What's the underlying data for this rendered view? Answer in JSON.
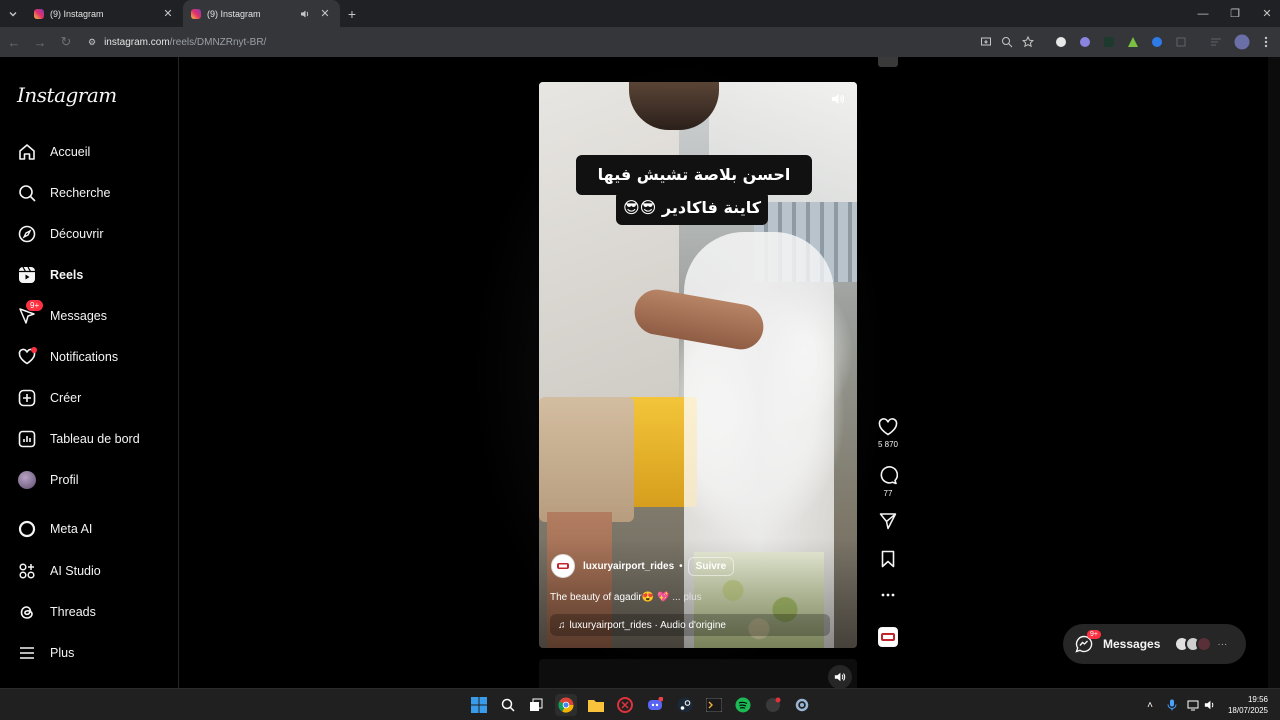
{
  "browser": {
    "tabs": [
      {
        "title": "(9) Instagram",
        "active": false
      },
      {
        "title": "(9) Instagram",
        "active": true
      }
    ],
    "url_domain": "instagram.com",
    "url_path": "/reels/DMNZRnyt-BR/"
  },
  "sidebar": {
    "logo": "Instagram",
    "items": [
      {
        "label": "Accueil",
        "icon": "home-icon"
      },
      {
        "label": "Recherche",
        "icon": "search-icon"
      },
      {
        "label": "Découvrir",
        "icon": "compass-icon"
      },
      {
        "label": "Reels",
        "icon": "reels-icon"
      },
      {
        "label": "Messages",
        "icon": "messenger-icon",
        "badge": "9+"
      },
      {
        "label": "Notifications",
        "icon": "heart-icon"
      },
      {
        "label": "Créer",
        "icon": "plus-square-icon"
      },
      {
        "label": "Tableau de bord",
        "icon": "dashboard-icon"
      },
      {
        "label": "Profil",
        "icon": "avatar"
      },
      {
        "label": "Meta AI",
        "icon": "meta-ai-icon"
      },
      {
        "label": "AI Studio",
        "icon": "ai-studio-icon"
      },
      {
        "label": "Threads",
        "icon": "threads-icon"
      },
      {
        "label": "Plus",
        "icon": "menu-icon"
      }
    ]
  },
  "reel": {
    "overlay_line1": "احسن بلاصة تشيش فيها",
    "overlay_line2": "كاينة فاكادير 😎😎",
    "author": "luxuryairport_rides",
    "separator": "•",
    "follow_label": "Suivre",
    "description": "The beauty of agadir😍 💖",
    "more_label": "... plus",
    "audio": "luxuryairport_rides · Audio d'origine",
    "likes": "5 870",
    "comments": "77"
  },
  "messages_float": {
    "label": "Messages",
    "badge": "9+"
  },
  "taskbar": {
    "time": "19:56",
    "date": "18/07/2025"
  },
  "colors": {
    "badge": "#ff3040",
    "background": "#000000",
    "chrome_tabbar": "#202124",
    "chrome_toolbar": "#35363a"
  }
}
